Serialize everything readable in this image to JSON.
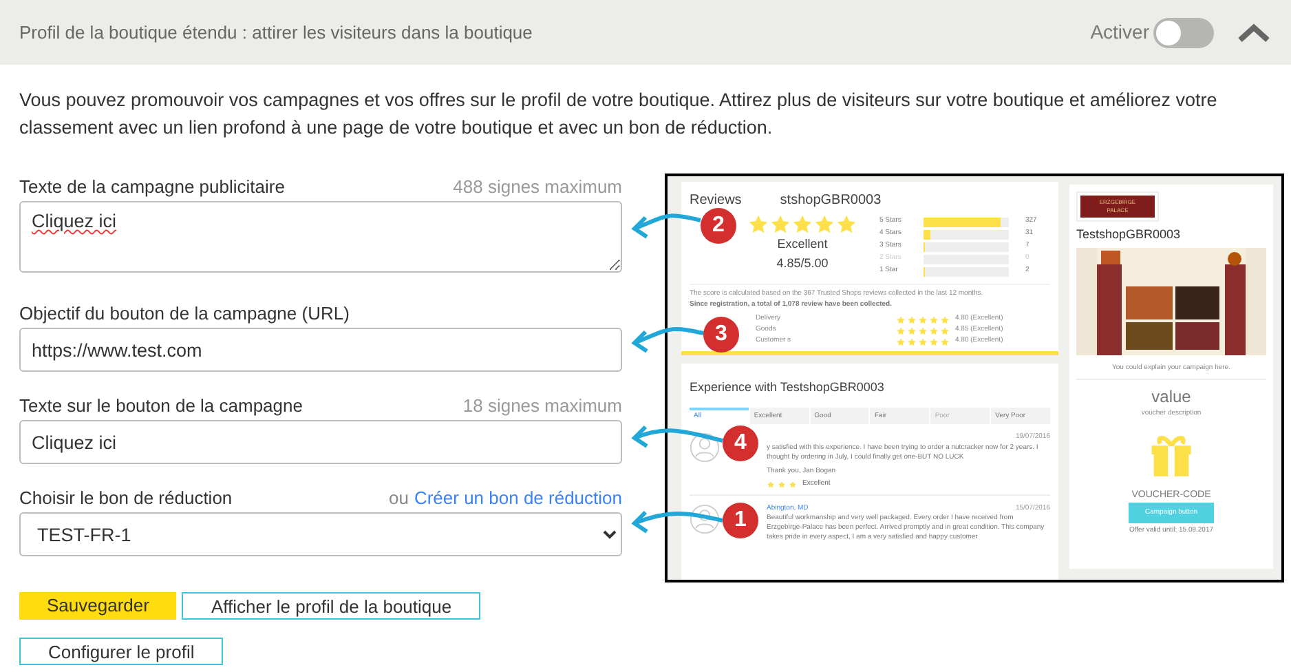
{
  "header": {
    "title": "Profil de la boutique étendu : attirer les visiteurs dans la boutique",
    "toggle_label": "Activer",
    "toggle_on": false
  },
  "intro": "Vous pouvez promouvoir vos campagnes et vos offres sur le profil de votre boutique. Attirez plus de visiteurs sur votre boutique et améliorez votre classement avec un lien profond à une page de votre boutique et avec un bon de réduction.",
  "fields": [
    {
      "kind": "textarea",
      "label": "Texte de la campagne publicitaire",
      "hint": "488 signes maximum",
      "value": "Cliquez ici"
    },
    {
      "kind": "input",
      "label": "Objectif du bouton de la campagne (URL)",
      "value": "https://www.test.com"
    },
    {
      "kind": "input",
      "label": "Texte sur le bouton de la campagne",
      "hint": "18 signes maximum",
      "value": "Cliquez ici"
    },
    {
      "kind": "select",
      "label": "Choisir le bon de réduction",
      "link_prefix": "ou",
      "link": "Créer un bon de réduction",
      "value": "TEST-FR-1"
    }
  ],
  "buttons": [
    {
      "label": "Sauvegarder",
      "kind": "primary"
    },
    {
      "label": "Afficher le profil de la boutique",
      "kind": "outline"
    },
    {
      "label": "Configurer le profil",
      "kind": "outline"
    }
  ],
  "preview": {
    "reviews": {
      "title_parts": [
        "Reviews",
        "stshopGBR0003"
      ],
      "stars": 5,
      "rating": "Excellent",
      "score": "4.85/5.00",
      "distribution": [
        {
          "label": "5 Stars",
          "level": 0.9,
          "count": "327",
          "disabled": false
        },
        {
          "label": "4 Stars",
          "level": 0.08,
          "count": "31",
          "disabled": false
        },
        {
          "label": "3 Stars",
          "level": 0.02,
          "count": "7",
          "disabled": false
        },
        {
          "label": "2 Stars",
          "level": 0,
          "count": "0",
          "disabled": true
        },
        {
          "label": "1 Star",
          "level": 0.01,
          "count": "2",
          "disabled": false
        }
      ],
      "note": "The score is calculated based on the 367 Trusted Shops reviews collected in the last 12 months.",
      "note_bold": "Since registration, a total of 1,078 review have been collected.",
      "criteria": [
        {
          "label": "Delivery",
          "score": "4.80 (Excellent)"
        },
        {
          "label": "Goods",
          "score": "4.85 (Excellent)"
        },
        {
          "label": "Customer s",
          "score": "4.80 (Excellent)"
        }
      ]
    },
    "experience": {
      "title": "Experience with TestshopGBR0003",
      "tabs": [
        {
          "label": "All",
          "selected": true,
          "disabled": false
        },
        {
          "label": "Excellent",
          "selected": false,
          "disabled": false
        },
        {
          "label": "Good",
          "selected": false,
          "disabled": false
        },
        {
          "label": "Fair",
          "selected": false,
          "disabled": false
        },
        {
          "label": "Poor",
          "selected": false,
          "disabled": true
        },
        {
          "label": "Very Poor",
          "selected": false,
          "disabled": false
        }
      ],
      "reviews": [
        {
          "text": "y satisfied with this experience. I have been trying to order a nutcracker now for 2 years. I thought by ordering in July, I could finally get one-BUT NO LUCK",
          "date": "19/07/2016",
          "sign": "Thank you, Jan Bogan",
          "rating": "Excellent"
        },
        {
          "author": "Abington, MD",
          "date": "15/07/2016",
          "text": "Beautiful workmanship and very well packaged. Every order I have received from Erzgebirge-Palace has been perfect. Arrived promptly and in great condition. This company takes pride in every aspect, I am a very satisfied and happy customer"
        }
      ]
    },
    "shop": {
      "logo": "ERZGEBIRGE PALACE",
      "name": "TestshopGBR0003",
      "campaign_text": "You could explain your campaign here.",
      "value": "value",
      "voucher_description": "voucher description",
      "voucher_code": "VOUCHER-CODE",
      "button": "Campaign button",
      "valid": "Offer valid until: 15.08.2017"
    },
    "markers": [
      {
        "label": "2"
      },
      {
        "label": "3"
      },
      {
        "label": "4"
      },
      {
        "label": "1"
      }
    ]
  }
}
